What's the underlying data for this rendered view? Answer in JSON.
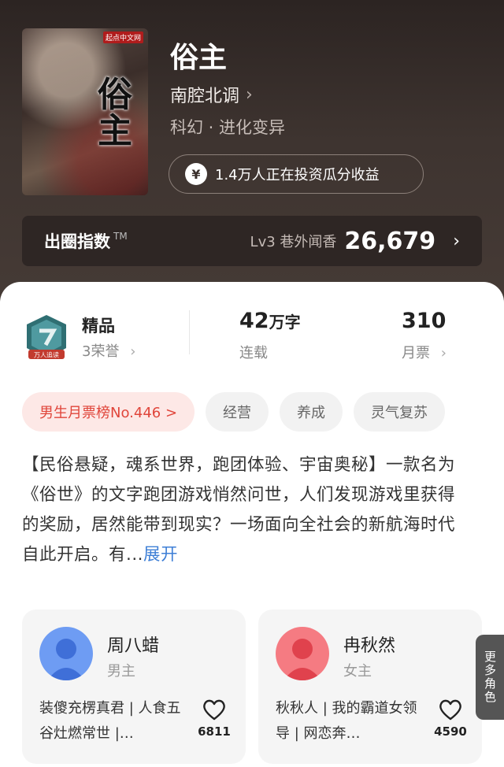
{
  "book": {
    "title": "俗主",
    "author": "南腔北调",
    "genre": "科幻 · 进化变异",
    "invest_text": "1.4万人正在投资瓜分收益",
    "cover": {
      "badge": "起点中文网",
      "cover_title": "俗主"
    }
  },
  "pop_index": {
    "label": "出圈指数",
    "tm": "TM",
    "level": "Lv3 巷外闻香",
    "value": "26,679"
  },
  "stats": {
    "honor": {
      "title": "精品",
      "sub": "3荣誉",
      "badge_text": "万人追读"
    },
    "words": {
      "num": "42",
      "unit": "万字",
      "sub": "连载"
    },
    "tickets": {
      "num": "310",
      "sub": "月票"
    }
  },
  "tags": [
    "男生月票榜No.446 >",
    "经营",
    "养成",
    "灵气复苏"
  ],
  "description": {
    "text": "【民俗悬疑，魂系世界，跑团体验、宇宙奥秘】一款名为《俗世》的文字跑团游戏悄然问世，人们发现游戏里获得的奖励，居然能带到现实？一场面向全社会的新航海时代自此开启。有...",
    "more": "展开"
  },
  "characters": [
    {
      "name": "周八蜡",
      "role": "男主",
      "bio": "装傻充楞真君 | 人食五谷灶燃常世 |…",
      "likes": "6811",
      "color": "#5b8df0"
    },
    {
      "name": "冉秋然",
      "role": "女主",
      "bio": "秋秋人 | 我的霸道女领导 | 网恋奔…",
      "likes": "4590",
      "color": "#f0646e"
    }
  ],
  "more_roles": "更多角色"
}
